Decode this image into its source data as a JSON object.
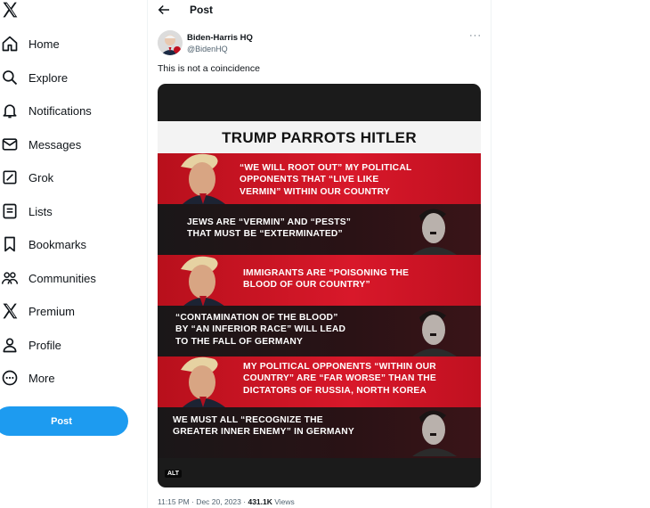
{
  "sidebar": {
    "logo": "x-logo-icon",
    "items": [
      {
        "label": "Home",
        "icon": "home-icon"
      },
      {
        "label": "Explore",
        "icon": "search-icon"
      },
      {
        "label": "Notifications",
        "icon": "bell-icon"
      },
      {
        "label": "Messages",
        "icon": "envelope-icon"
      },
      {
        "label": "Grok",
        "icon": "grok-icon"
      },
      {
        "label": "Lists",
        "icon": "list-icon"
      },
      {
        "label": "Bookmarks",
        "icon": "bookmark-icon"
      },
      {
        "label": "Communities",
        "icon": "people-icon"
      },
      {
        "label": "Premium",
        "icon": "x-logo-icon"
      },
      {
        "label": "Profile",
        "icon": "person-icon"
      },
      {
        "label": "More",
        "icon": "more-circle-icon"
      }
    ],
    "post_label": "Post"
  },
  "header": {
    "title": "Post",
    "back_icon": "arrow-left-icon"
  },
  "tweet": {
    "author_name": "Biden-Harris HQ",
    "author_handle": "@BidenHQ",
    "text": "This is not a coincidence",
    "image": {
      "title": "TRUMP PARROTS HITLER",
      "rows": [
        {
          "speaker": "trump",
          "quote_lines": [
            "“WE WILL ROOT OUT” MY POLITICAL",
            "OPPONENTS THAT “LIVE LIKE",
            "VERMIN” WITHIN OUR COUNTRY"
          ]
        },
        {
          "speaker": "hitler",
          "quote_lines": [
            "JEWS ARE “VERMIN” AND “PESTS”",
            "THAT MUST BE “EXTERMINATED”"
          ]
        },
        {
          "speaker": "trump",
          "quote_lines": [
            "IMMIGRANTS ARE “POISONING THE",
            "BLOOD OF OUR COUNTRY”"
          ]
        },
        {
          "speaker": "hitler",
          "quote_lines": [
            "“CONTAMINATION OF THE BLOOD”",
            "BY “AN INFERIOR RACE” WILL LEAD",
            "TO THE FALL OF GERMANY"
          ]
        },
        {
          "speaker": "trump",
          "quote_lines": [
            "MY POLITICAL OPPONENTS “WITHIN OUR",
            "COUNTRY” ARE “FAR WORSE” THAN THE",
            "DICTATORS OF RUSSIA, NORTH KOREA"
          ]
        },
        {
          "speaker": "hitler",
          "quote_lines": [
            "WE MUST ALL “RECOGNIZE THE",
            "GREATER INNER ENEMY” IN GERMANY"
          ]
        }
      ],
      "alt_label": "ALT"
    },
    "timestamp": "11:15 PM · Dec 20, 2023",
    "separator": "·",
    "views_count": "431.1K",
    "views_label": "Views"
  },
  "colors": {
    "accent": "#1d9bf0",
    "red_band": "#d8182a",
    "dark_band": "#2a1215"
  }
}
